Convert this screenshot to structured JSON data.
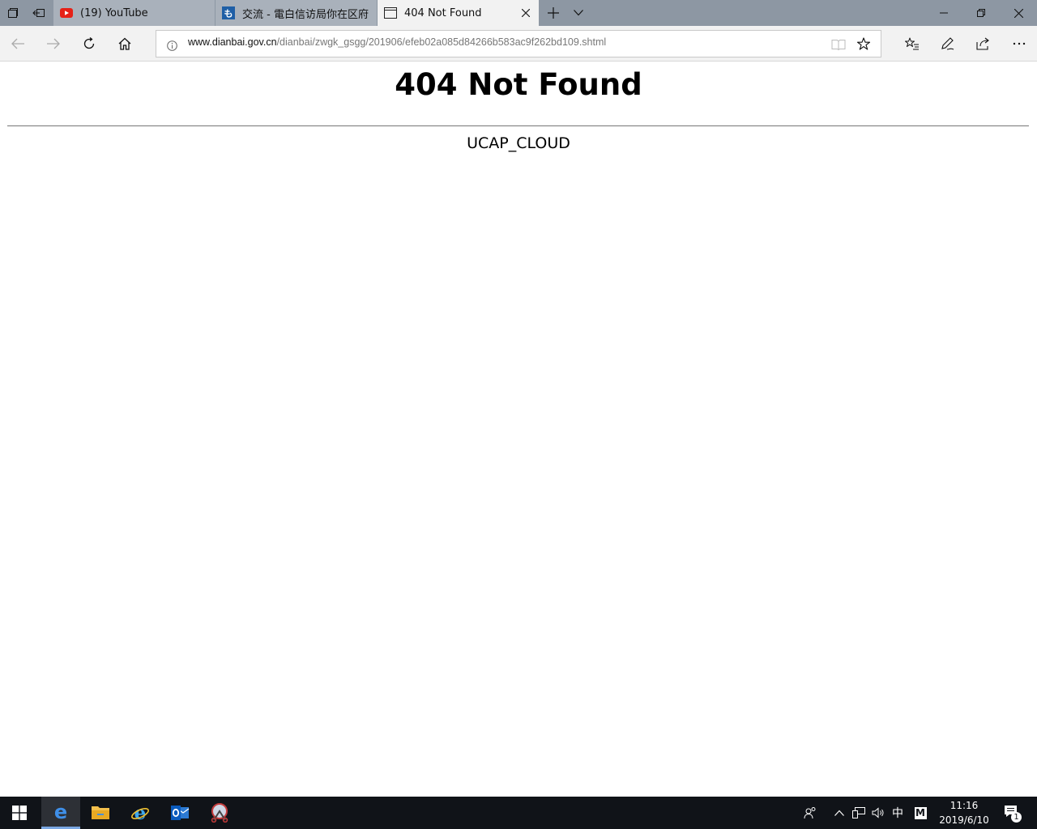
{
  "browser": {
    "tabs": [
      {
        "label": "(19) YouTube",
        "favicon": "youtube-icon",
        "active": false
      },
      {
        "label": "交流 - 電白信访局你在区府",
        "favicon": "telecom-icon",
        "active": false
      },
      {
        "label": "404 Not Found",
        "favicon": "page-icon",
        "active": true
      }
    ],
    "address": {
      "host": "www.dianbai.gov.cn",
      "path": "/dianbai/zwgk_gsgg/201906/efeb02a085d84266b583ac9f262bd109.shtml"
    }
  },
  "page": {
    "title": "404 Not Found",
    "server": "UCAP_CLOUD"
  },
  "taskbar": {
    "ime": "中",
    "ime_mode": "M",
    "time": "11:16",
    "date": "2019/6/10",
    "notification_count": "1"
  },
  "colors": {
    "titlebar": "#8d97a3",
    "accent": "#0078d7",
    "taskbar": "#101318"
  }
}
